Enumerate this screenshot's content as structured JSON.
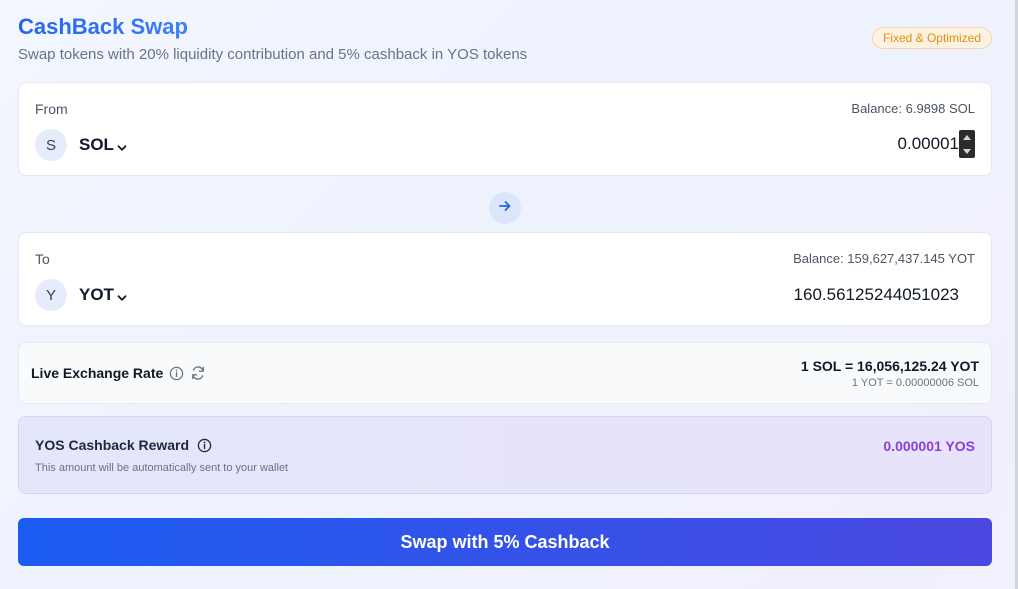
{
  "header": {
    "title": "CashBack Swap",
    "subtitle": "Swap tokens with 20% liquidity contribution and 5% cashback in YOS tokens",
    "badge": "Fixed & Optimized"
  },
  "from": {
    "label": "From",
    "balance": "Balance: 6.9898 SOL",
    "token_avatar": "S",
    "token_symbol": "SOL",
    "amount": "0.00001",
    "icons": {
      "dropdown": "chevron-down-icon",
      "spinner": "number-spinner"
    }
  },
  "swap_direction": {
    "icon": "arrow-right-icon"
  },
  "to": {
    "label": "To",
    "balance": "Balance: 159,627,437.145 YOT",
    "token_avatar": "Y",
    "token_symbol": "YOT",
    "amount": "160.56125244051023",
    "icons": {
      "dropdown": "chevron-down-icon"
    }
  },
  "rate": {
    "title": "Live Exchange Rate",
    "primary": "1 SOL = 16,056,125.24 YOT",
    "secondary": "1 YOT = 0.00000006 SOL",
    "icons": {
      "info": "info-icon",
      "refresh": "refresh-icon"
    }
  },
  "cashback": {
    "title": "YOS Cashback Reward",
    "note": "This amount will be automatically sent to your wallet",
    "value": "0.000001 YOS",
    "icons": {
      "info": "info-icon"
    }
  },
  "action": {
    "swap_label": "Swap with 5% Cashback"
  },
  "colors": {
    "accent": "#2563eb",
    "button_start": "#1b5cf2",
    "button_end": "#4a48e0",
    "cashback_value": "#8b3fd6",
    "badge_text": "#e0901a"
  }
}
